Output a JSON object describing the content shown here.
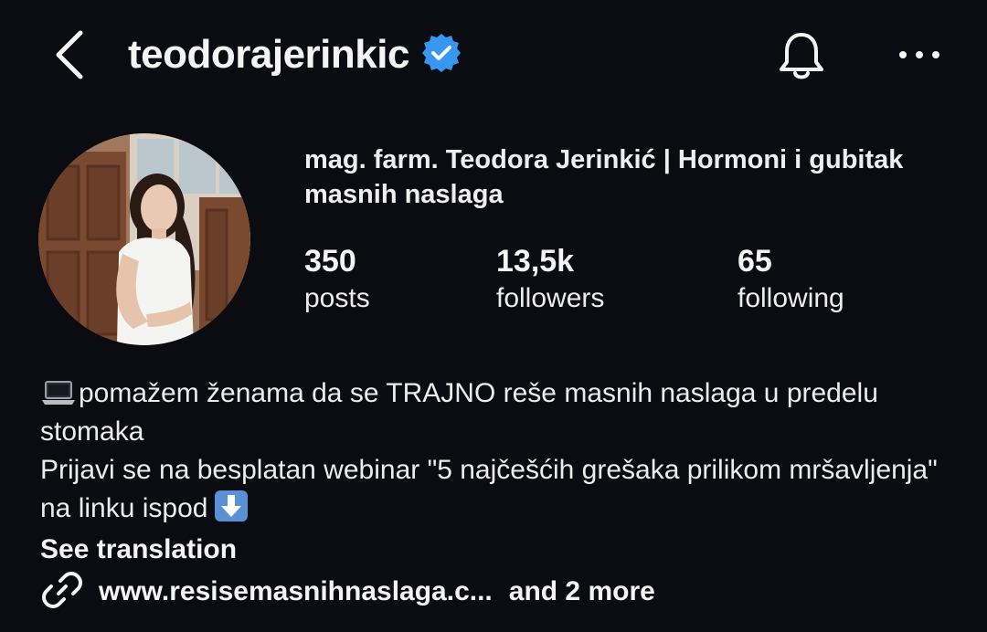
{
  "header": {
    "username": "teodorajerinkic",
    "icons": {
      "back": "chevron-left-icon",
      "verified": "verified-badge-icon",
      "bell": "bell-icon",
      "more": "more-horizontal-icon"
    }
  },
  "profile": {
    "full_name": "mag. farm. Teodora Jerinkić | Hormoni i gubitak masnih naslaga",
    "avatar_icon": "profile-photo",
    "stats": [
      {
        "value": "350",
        "label": "posts"
      },
      {
        "value": "13,5k",
        "label": "followers"
      },
      {
        "value": "65",
        "label": "following"
      }
    ]
  },
  "bio": {
    "line1_emoji": "laptop-emoji",
    "line1": "pomažem ženama da se TRAJNO reše masnih naslaga u predelu stomaka",
    "line2": "Prijavi se na besplatan webinar \"5 najčešćih grešaka prilikom mršavljenja\" na linku ispod",
    "line2_emoji": "down-arrow-emoji",
    "see_translation": "See translation"
  },
  "link": {
    "url": "www.resisemasnihnaslaga.c...",
    "more": "and 2 more",
    "icon": "link-icon"
  },
  "colors": {
    "background": "#0b0b12",
    "text": "#f2f2f2",
    "verified": "#3897f0"
  }
}
